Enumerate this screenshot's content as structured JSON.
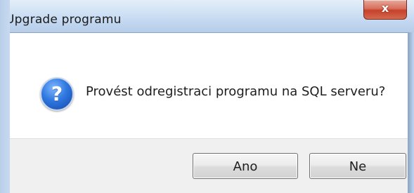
{
  "window": {
    "title": "Upgrade programu",
    "close_glyph": "x"
  },
  "dialog": {
    "icon": "question-icon",
    "icon_glyph": "?",
    "message": "Provést odregistraci programu na SQL serveru?"
  },
  "buttons": {
    "yes_label": "Ano",
    "no_label": "Ne"
  },
  "colors": {
    "titlebar": "#c1d6ef",
    "close_button": "#c6412b",
    "question_icon": "#2f78e0",
    "footer": "#f0f0f0"
  }
}
